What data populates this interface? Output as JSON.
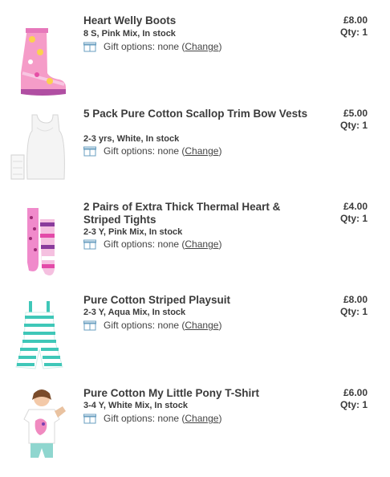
{
  "gift_prefix": "Gift options: none (",
  "gift_suffix": ")",
  "change_label": "Change",
  "items": [
    {
      "title": "Heart Welly Boots",
      "meta": "8 S, Pink Mix, In stock",
      "price": "£8.00",
      "qty": "Qty: 1",
      "icon": "welly-boots-thumbnail"
    },
    {
      "title": "5 Pack Pure Cotton Scallop Trim Bow Vests",
      "meta": "2-3 yrs, White, In stock",
      "price": "£5.00",
      "qty": "Qty: 1",
      "icon": "vests-thumbnail"
    },
    {
      "title": "2 Pairs of Extra Thick Thermal Heart & Striped Tights",
      "meta": "2-3 Y, Pink Mix, In stock",
      "price": "£4.00",
      "qty": "Qty: 1",
      "icon": "tights-thumbnail"
    },
    {
      "title": "Pure Cotton Striped Playsuit",
      "meta": "2-3 Y, Aqua Mix, In stock",
      "price": "£8.00",
      "qty": "Qty: 1",
      "icon": "playsuit-thumbnail"
    },
    {
      "title": "Pure Cotton My Little Pony T-Shirt",
      "meta": "3-4 Y, White Mix, In stock",
      "price": "£6.00",
      "qty": "Qty: 1",
      "icon": "tshirt-thumbnail"
    }
  ]
}
